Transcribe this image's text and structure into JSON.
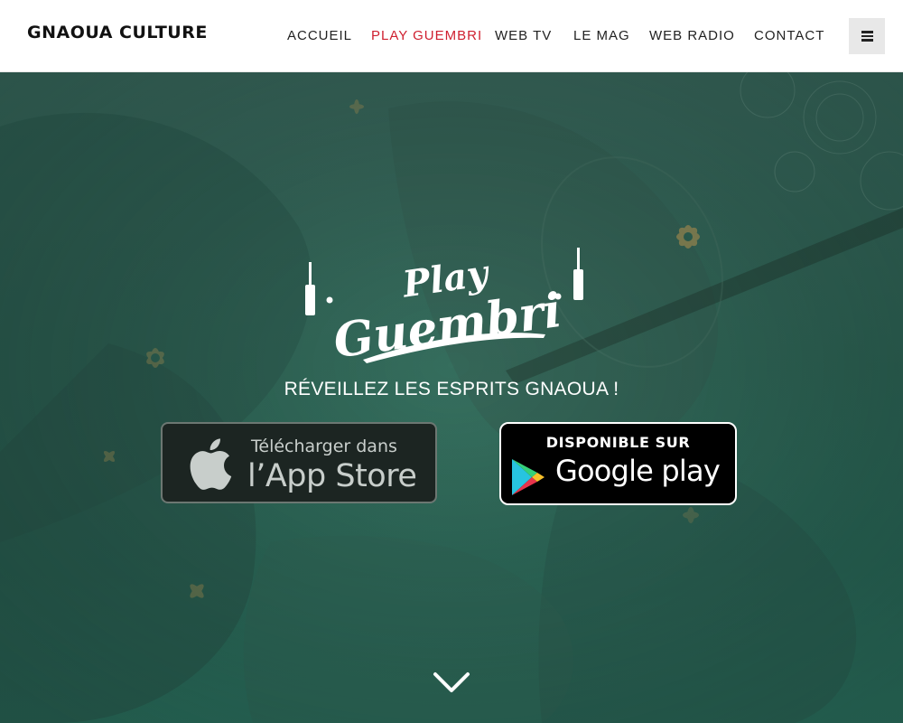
{
  "header": {
    "brand": "GNAOUA CULTURE",
    "nav": [
      {
        "label": "ACCUEIL",
        "active": false
      },
      {
        "label": "PLAY GUEMBRI",
        "active": true
      },
      {
        "label": "WEB TV",
        "active": false
      },
      {
        "label": "LE MAG",
        "active": false
      },
      {
        "label": "WEB RADIO",
        "active": false
      },
      {
        "label": "CONTACT",
        "active": false
      }
    ],
    "menu_icon": "hamburger-menu-icon",
    "active_color": "#cf1f2f"
  },
  "hero": {
    "logo_line1": "Play",
    "logo_line2": "Guembri",
    "tagline": "RÉVEILLEZ LES ESPRITS GNAOUA !",
    "background_tint": "#2f6657",
    "app_store": {
      "line1": "Télécharger dans",
      "line2": "l’App Store",
      "icon": "apple-icon"
    },
    "google_play": {
      "line1": "DISPONIBLE SUR",
      "line2": "Google play",
      "icon": "google-play-icon"
    },
    "scroll_icon": "chevron-down-icon"
  }
}
